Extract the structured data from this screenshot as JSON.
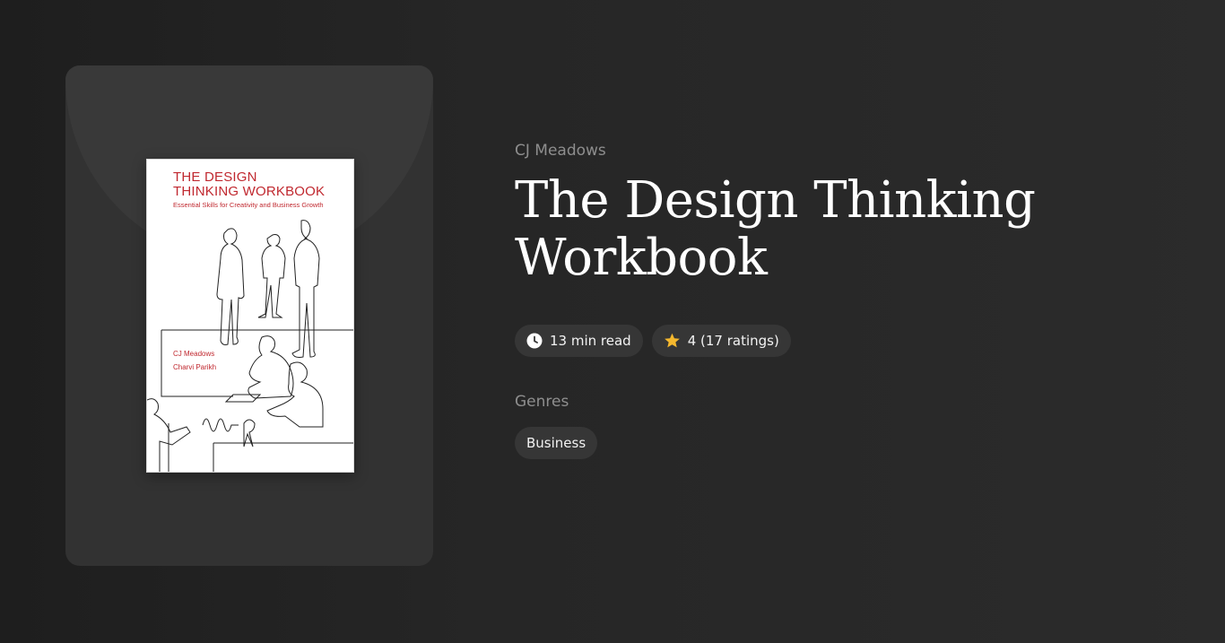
{
  "book": {
    "author": "CJ Meadows",
    "title_line1": "The Design Thinking",
    "title_line2": "Workbook",
    "read_time": "13 min read",
    "rating": "4 (17 ratings)"
  },
  "cover": {
    "title_line1": "THE DESIGN",
    "title_line2": "THINKING WORKBOOK",
    "subtitle": "Essential Skills for Creativity and Business Growth",
    "author1": "CJ Meadows",
    "author2": "Charvi Parikh",
    "title_color": "#c0282f"
  },
  "genres": {
    "label": "Genres",
    "items": [
      "Business"
    ]
  },
  "icons": {
    "read_time": "clock-icon",
    "rating": "star-icon"
  },
  "colors": {
    "star": "#f5b82e",
    "pill_bg": "#363636",
    "muted_text": "#8e8e8e"
  }
}
